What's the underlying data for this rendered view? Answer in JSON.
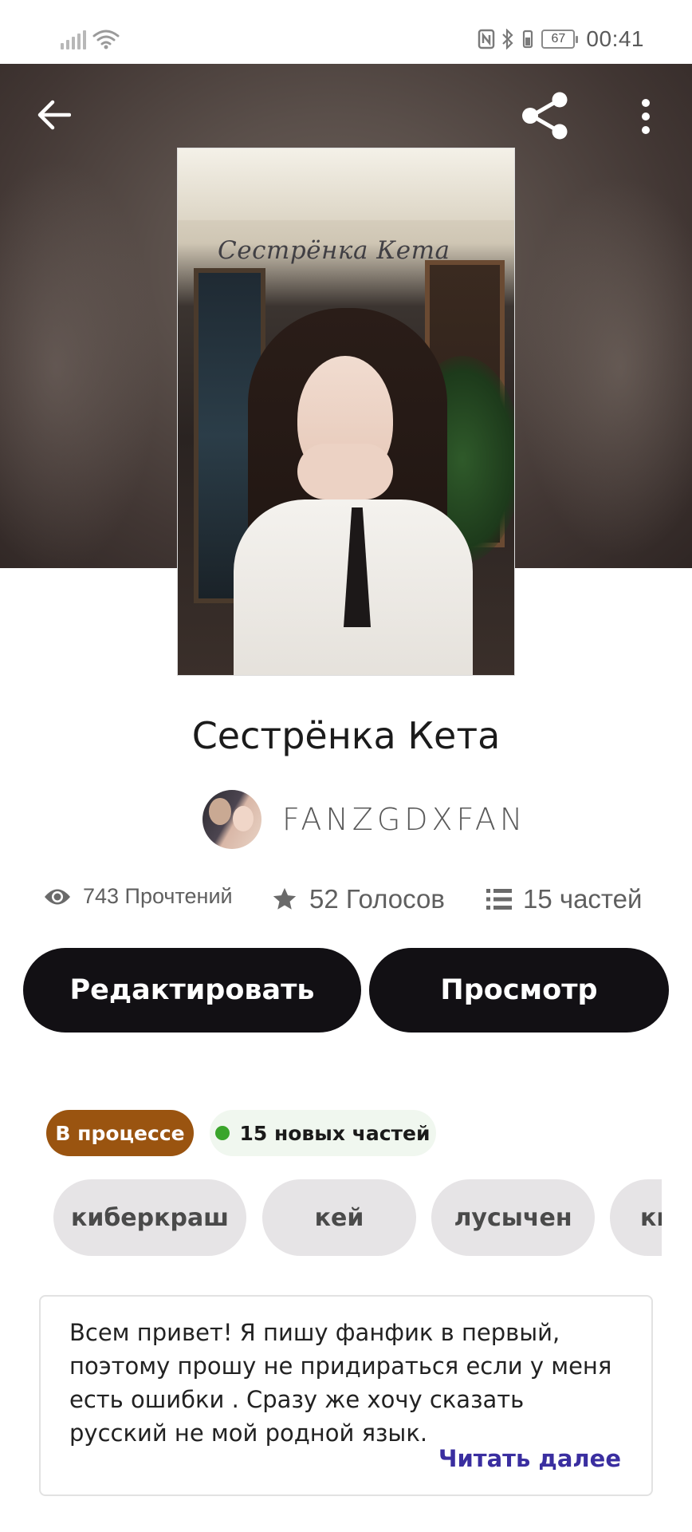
{
  "status_bar": {
    "time": "00:41",
    "battery": "67",
    "icons": [
      "signal-icon",
      "wifi-icon",
      "nfc-icon",
      "bluetooth-icon",
      "vibrate-icon",
      "battery-icon"
    ]
  },
  "header": {
    "back_icon": "arrow-left-icon",
    "share_icon": "share-icon",
    "more_icon": "more-vertical-icon",
    "background_color": "#4a3f3b"
  },
  "cover": {
    "title_overlay": "Сестрёнка Кета"
  },
  "story": {
    "title": "Сестрёнка Кета",
    "author": "FANZGDXFAN"
  },
  "stats": {
    "reads": "743 Прочтений",
    "votes": "52 Голосов",
    "parts": "15 частей"
  },
  "actions": {
    "edit_label": "Редактировать",
    "preview_label": "Просмотр"
  },
  "badges": {
    "status": "В процессе",
    "new_parts": "15 новых частей",
    "status_color": "#9a5410",
    "new_dot_color": "#3aa52b"
  },
  "tags": [
    "киберкраш",
    "кей",
    "лусычен",
    "ки"
  ],
  "description": {
    "text": "Всем привет! Я пишу фанфик в первый, поэтому прошу не придираться если у меня есть ошибки . Сразу же хочу сказать русский не мой родной язык.",
    "read_more": "Читать далее",
    "link_color": "#3a2ea0"
  }
}
